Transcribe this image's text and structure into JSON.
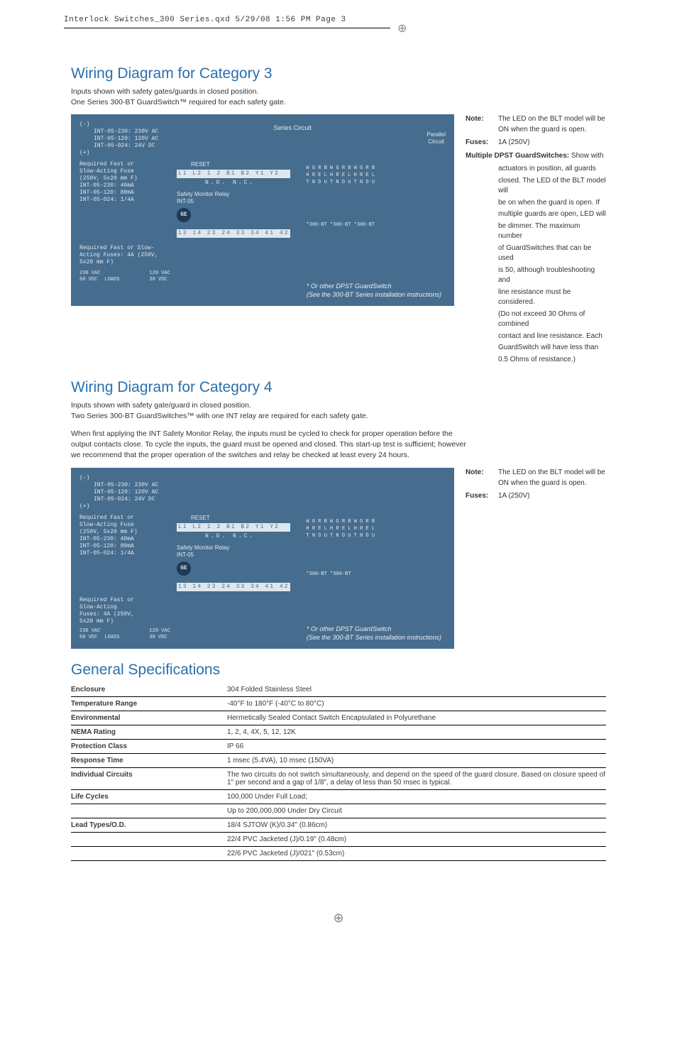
{
  "prepress": "Interlock Switches_300 Series.qxd  5/29/08  1:56 PM  Page 3",
  "section1": {
    "title": "Wiring Diagram for Category 3",
    "sub1": "Inputs shown with safety gates/guards in closed position.",
    "sub2": "One Series 300-BT GuardSwitch™ required for each safety gate."
  },
  "diagram1": {
    "l1": "(-)",
    "l2": "INT-05-230: 230V AC",
    "l3": "INT-05-120: 120V AC",
    "l4": "INT-05-024: 24V DC",
    "l5": "(+)",
    "l6": "RESET",
    "l7": "Required Fast or",
    "l8": "Slow-Acting Fuse",
    "l9": "(250V, 5x20 mm F)",
    "l10": "INT-05-230: 40mA",
    "l11": "INT-05-120: 80mA",
    "l12": "INT-05-024: 1/4A",
    "l13": "Safety Monitor Relay",
    "l14": "INT-05",
    "series": "Series Circuit",
    "parallel": "Parallel\nCircuit",
    "tags": "W  G  R  B          W  G  R  B          W  G  R  B",
    "tags2": "H  R  E  L          H  R  E  L          H  R  E  L",
    "tags3": "T  N  D  U          T  N  D  U          T  N  D  U",
    "terms": "L1 L2 1  2  B1 B2 Y1 Y2",
    "nonc": "N.O.    N.C.",
    "bt": "*300-BT                 *300-BT                 *300-BT",
    "outrow": "13 14 23 24 33 34 41 42",
    "bottom1": "Required Fast or Slow-",
    "bottom2": "Acting Fuses: 4A (250V,",
    "bottom3": "5x20 mm F)",
    "volts1": "230 VAC",
    "volts2": "60 VDC",
    "loads": "LOADS",
    "volts3": "120 VAC",
    "volts4": "30 VDC",
    "foot1": "*  Or other DPST GuardSwitch",
    "foot2": "(See the 300-BT Series installation instructions)"
  },
  "notes1": {
    "note_lbl": "Note:",
    "note_txt": "The LED on the BLT model will be ON when the guard is open.",
    "fuses_lbl": "Fuses:",
    "fuses_txt": "1A (250V)",
    "multi_lbl": "Multiple DPST GuardSwitches:",
    "multi_txt_lead": " Show with",
    "multi_lines": [
      "actuators in position, all guards",
      "closed. The LED of the BLT model will",
      "be on when the guard is open. If",
      "multiple guards are open, LED will",
      "be dimmer. The maximum number",
      "of GuardSwitches that can be used",
      "is 50, although troubleshooting and",
      "line resistance must be considered.",
      "(Do not exceed 30 Ohms of combined",
      "contact and line resistance. Each",
      "GuardSwitch will have less than",
      "0.5 Ohms of resistance.)"
    ]
  },
  "section2": {
    "title": "Wiring Diagram for Category 4",
    "sub1": "Inputs shown with safety gate/guard in closed position.",
    "sub2": "Two Series 300-BT GuardSwitches™ with one INT relay are required for each safety gate.",
    "para": "When first applying the INT Safety Monitor Relay, the inputs must be cycled to check for proper operation before the output contacts close. To cycle the inputs, the guard must be opened and closed. This start-up test is sufficient; however we recommend that the proper operation of the switches and relay be checked at least every 24 hours."
  },
  "diagram2": {
    "l2": "INT-05-230: 230V AC",
    "l3": "INT-05-120: 120V AC",
    "l4": "INT-05-024: 24V DC",
    "l7": "Required Fast or",
    "l8": "Slow-Acting Fuse",
    "l9": "(250V, 5x20 mm F)",
    "l10": "INT-05-230: 40mA",
    "l11": "INT-05-120: 80mA",
    "l12": "INT-05-024: 1/4A",
    "l13": "Safety Monitor Relay",
    "l14": "INT-05",
    "bt": "*300-BT                 *300-BT",
    "bottom1": "Required Fast or",
    "bottom2": "Slow-Acting",
    "bottom3": "Fuses: 4A (250V,",
    "bottom4": "5x20 mm F)"
  },
  "notes2": {
    "note_lbl": "Note:",
    "note_txt": "The LED on the BLT model will be ON when the guard is open.",
    "fuses_lbl": "Fuses:",
    "fuses_txt": "1A (250V)"
  },
  "section3": {
    "title": "General Specifications"
  },
  "specs": [
    {
      "k": "Enclosure",
      "v": "304 Folded Stainless Steel"
    },
    {
      "k": "Temperature Range",
      "v": "-40°F to 180°F (-40°C to 80°C)"
    },
    {
      "k": "Environmental",
      "v": "Hermetically Sealed Contact Switch Encapsulated in Polyurethane"
    },
    {
      "k": "NEMA Rating",
      "v": "1, 2, 4, 4X, 5, 12, 12K"
    },
    {
      "k": "Protection Class",
      "v": "IP 66"
    },
    {
      "k": "Response Time",
      "v": "1 msec (5.4VA), 10 msec (150VA)"
    },
    {
      "k": "Individual Circuits",
      "v": "The two circuits do not switch simultaneously, and depend on the speed of the guard closure. Based on closure speed of 1\" per second and a gap of 1/8\", a delay of less than 50 msec is typical."
    },
    {
      "k": "Life Cycles",
      "v": "100,000 Under Full Load;"
    },
    {
      "k": "",
      "v": "Up to 200,000,000 Under Dry Circuit"
    },
    {
      "k": "Lead Types/O.D.",
      "v": "18/4 SJTOW (K)/0.34\" (0.86cm)"
    },
    {
      "k": "",
      "v": "22/4 PVC Jacketed (J)/0.19\" (0.48cm)"
    },
    {
      "k": "",
      "v": "22/6 PVC Jacketed (J)/021\" (0.53cm)"
    }
  ]
}
